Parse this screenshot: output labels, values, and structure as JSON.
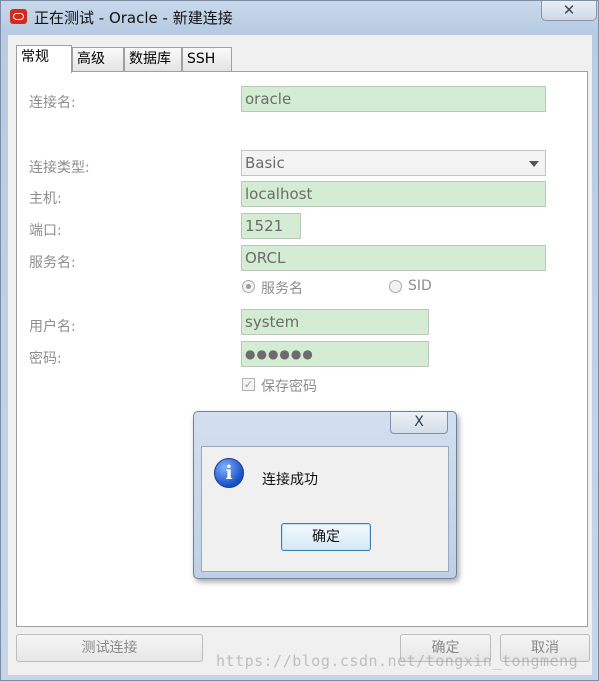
{
  "window": {
    "title": "正在测试 - Oracle - 新建连接",
    "close_glyph": "✕"
  },
  "tabs": [
    {
      "label": "常规",
      "active": true
    },
    {
      "label": "高级",
      "active": false
    },
    {
      "label": "数据库",
      "active": false
    },
    {
      "label": "SSH",
      "active": false
    }
  ],
  "form": {
    "connection_name": {
      "label": "连接名:",
      "value": "oracle"
    },
    "connection_type": {
      "label": "连接类型:",
      "value": "Basic"
    },
    "host": {
      "label": "主机:",
      "value": "localhost"
    },
    "port": {
      "label": "端口:",
      "value": "1521"
    },
    "service_name": {
      "label": "服务名:",
      "value": "ORCL"
    },
    "service_mode": {
      "options": [
        {
          "label": "服务名",
          "checked": true
        },
        {
          "label": "SID",
          "checked": false
        }
      ]
    },
    "username": {
      "label": "用户名:",
      "value": "system"
    },
    "password": {
      "label": "密码:",
      "value": "●●●●●●"
    },
    "save_password": {
      "label": "保存密码",
      "checked": true,
      "check_glyph": "✓"
    }
  },
  "footer": {
    "test_button": "测试连接",
    "ok_button": "确定",
    "cancel_button": "取消"
  },
  "dialog": {
    "close_glyph": "X",
    "icon_glyph": "i",
    "message": "连接成功",
    "ok_button": "确定"
  },
  "watermark": "https://blog.csdn.net/tongxin_tongmeng",
  "colors": {
    "field_bg": "#d4ebd4",
    "window_frame": "#b7cbe2",
    "info_icon": "#1a4fc4"
  }
}
